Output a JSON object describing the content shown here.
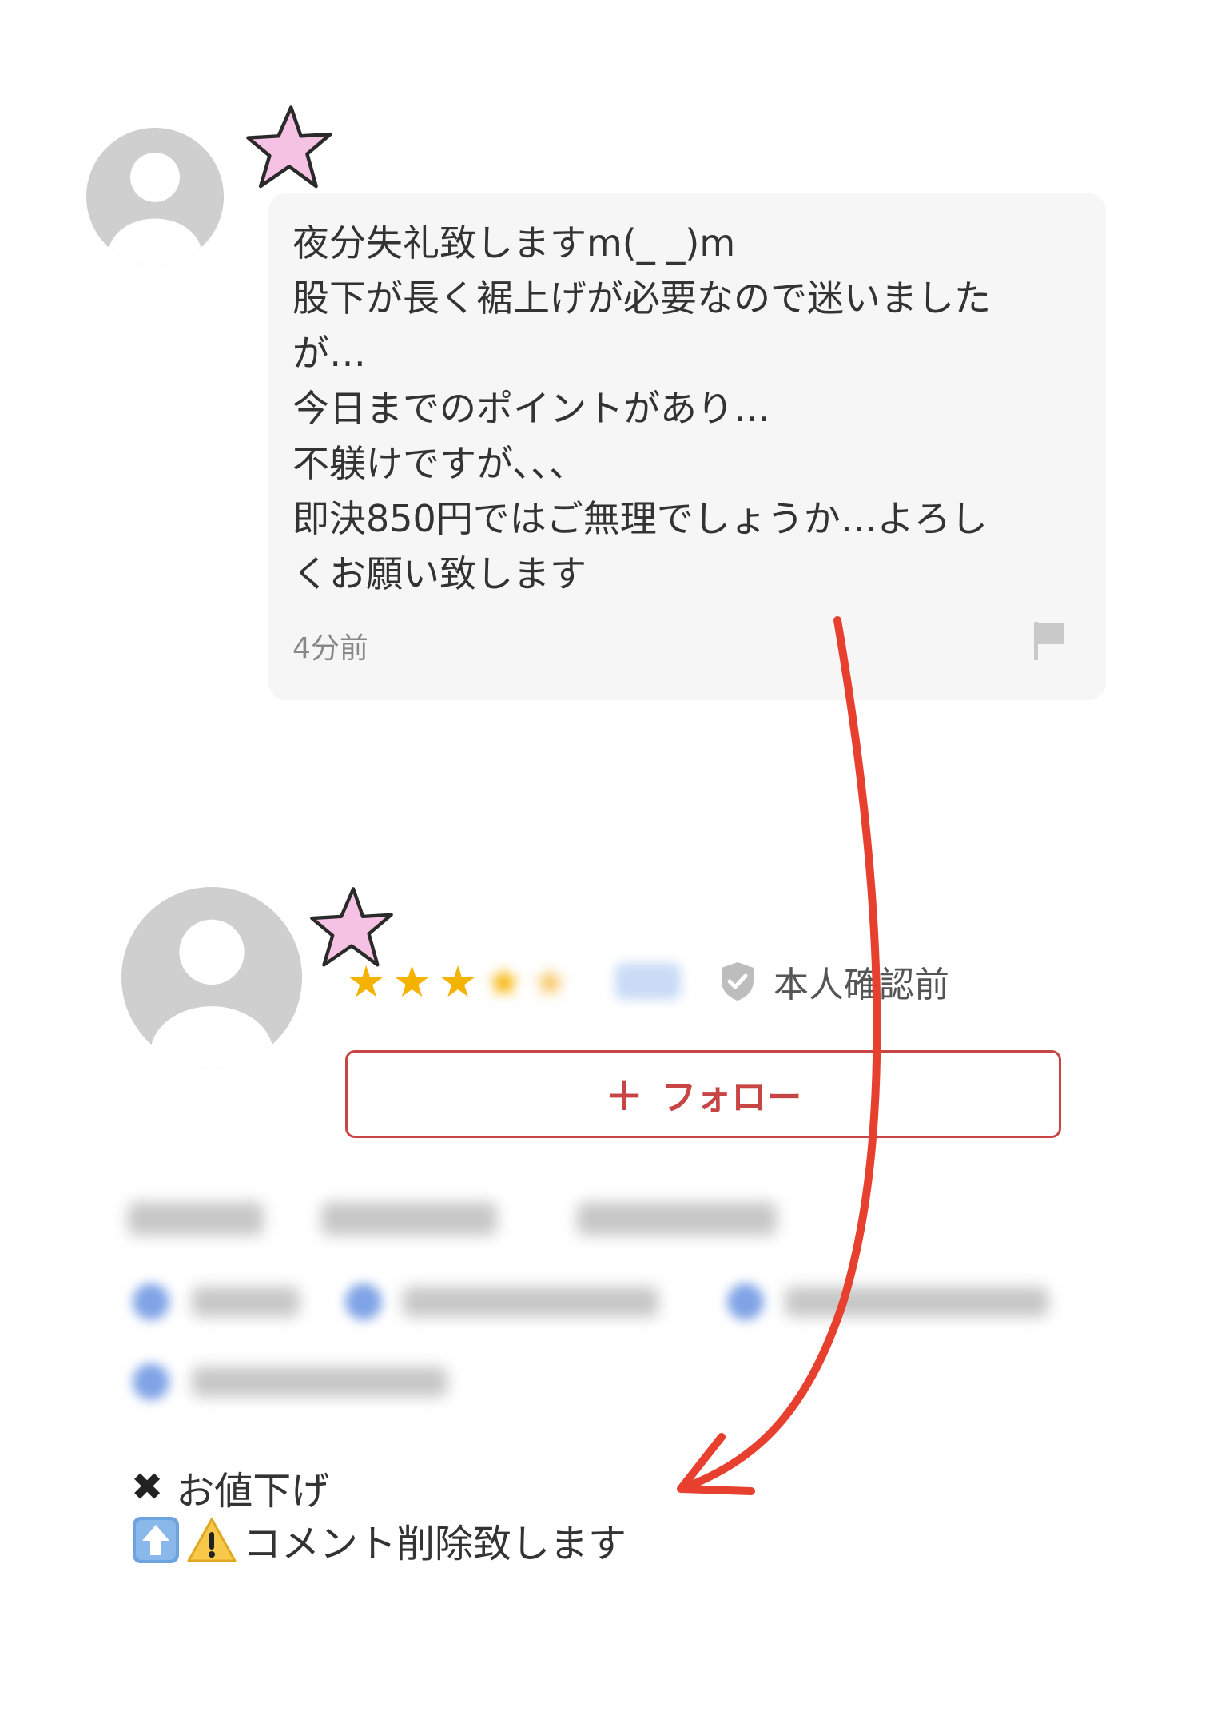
{
  "comment": {
    "lines": [
      "夜分失礼致しますm(_ _)m",
      "股下が長く裾上げが必要なので迷いました",
      "が…",
      "今日までのポイントがあり…",
      "不躾けですが、、、",
      "即決850円ではご無理でしょうか…よろし",
      "くお願い致します"
    ],
    "time": "4分前"
  },
  "seller": {
    "rating_stars_visible": 3,
    "verification_label": "本人確認前",
    "follow_label": "フォロー"
  },
  "annotation": {
    "line1": "お値下げ",
    "line2": "コメント削除致します"
  },
  "colors": {
    "arrow": "#e8402f",
    "follow": "#c84545",
    "star": "#f5b301",
    "sticker": "#f5c2e3"
  },
  "icons": {
    "flag": "flag-icon",
    "shield": "shield-check-icon",
    "up": "up-arrow-emoji-icon",
    "warning": "warning-emoji-icon"
  }
}
